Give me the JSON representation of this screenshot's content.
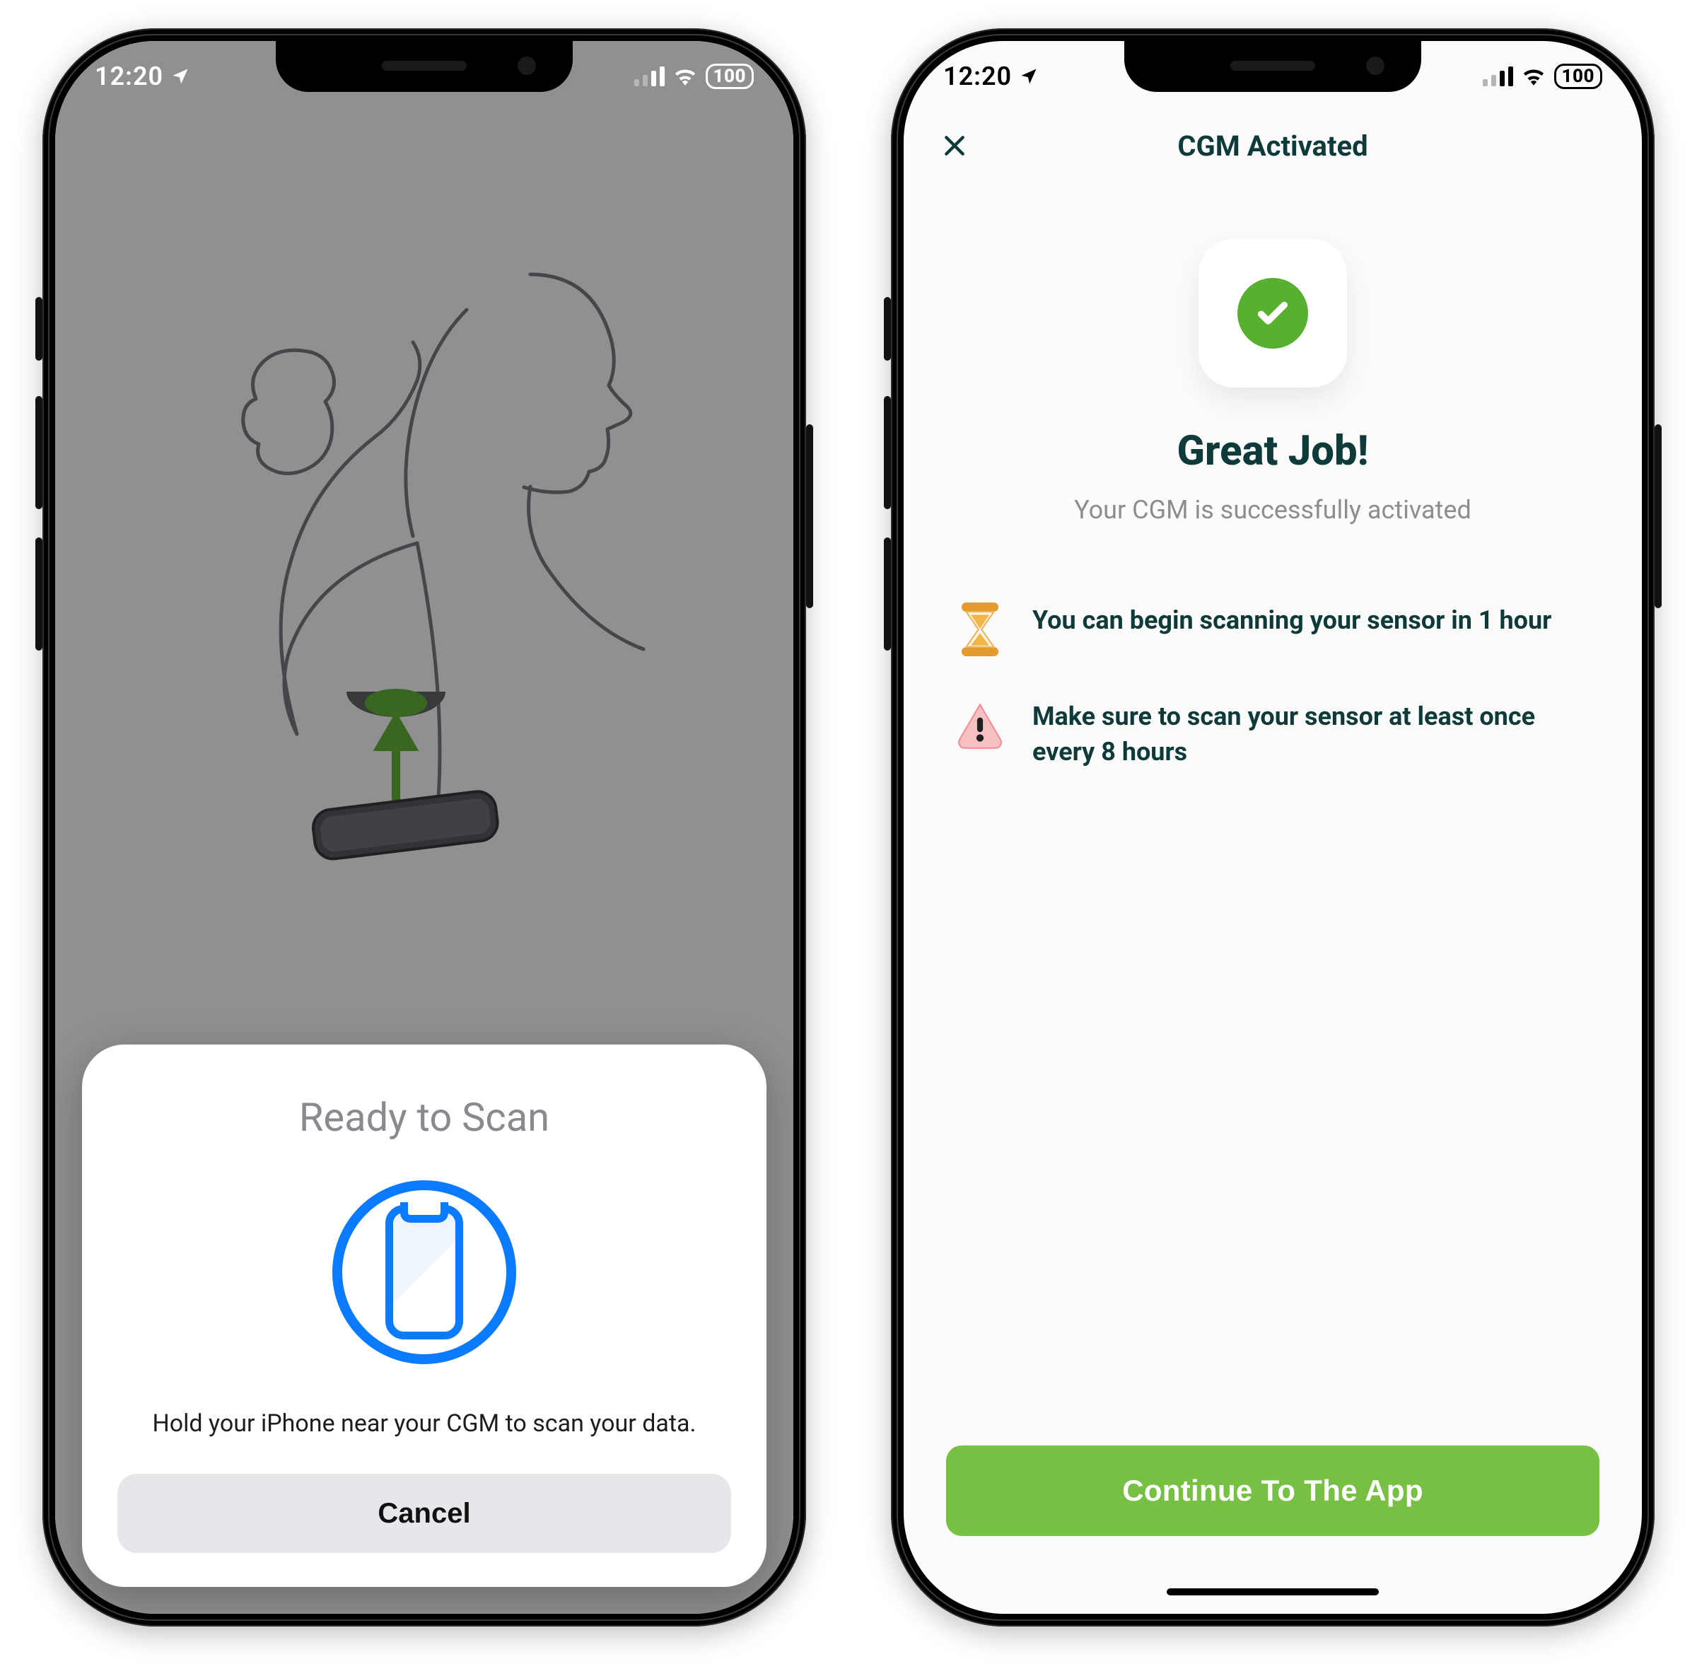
{
  "status": {
    "time": "12:20",
    "battery_label": "100"
  },
  "screen1": {
    "sheet_title": "Ready to Scan",
    "sheet_message": "Hold your iPhone near your CGM to scan your data.",
    "cancel_label": "Cancel"
  },
  "screen2": {
    "title": "CGM Activated",
    "great_title": "Great Job!",
    "great_subtitle": "Your CGM is successfully activated",
    "info": [
      {
        "icon": "hourglass-icon",
        "text": "You can begin scanning your sensor in 1 hour"
      },
      {
        "icon": "alert-icon",
        "text": "Make sure to scan your sensor at least once every 8 hours"
      }
    ],
    "continue_label": "Continue To The App"
  },
  "colors": {
    "accent_blue": "#0a7aff",
    "accent_green": "#77c043",
    "success_green": "#57b02f",
    "text_dark": "#0e3a3a"
  }
}
